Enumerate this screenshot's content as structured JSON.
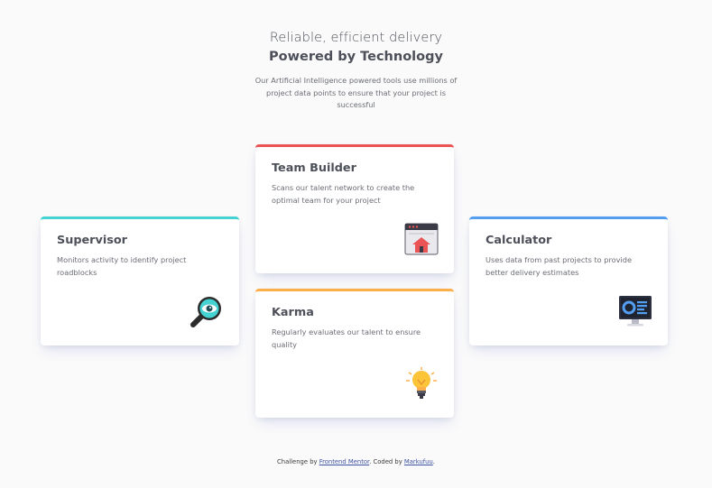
{
  "header": {
    "subtitle": "Reliable, efficient delivery",
    "title": "Powered by Technology",
    "description": "Our Artificial Intelligence powered tools use millions of project data points to ensure that your project is successful"
  },
  "cards": {
    "supervisor": {
      "title": "Supervisor",
      "text": "Monitors activity to identify project roadblocks",
      "accent": "#44d3d2",
      "icon": "magnifier-eye-icon"
    },
    "team_builder": {
      "title": "Team Builder",
      "text": "Scans our talent network to create the optimal team for your project",
      "accent": "#ea5454",
      "icon": "browser-house-icon"
    },
    "karma": {
      "title": "Karma",
      "text": "Regularly evaluates our talent to ensure quality",
      "accent": "#fcaf4a",
      "icon": "lightbulb-icon"
    },
    "calculator": {
      "title": "Calculator",
      "text": "Uses data from past projects to provide better delivery estimates",
      "accent": "#549ef2",
      "icon": "monitor-dashboard-icon"
    }
  },
  "footer": {
    "prefix": "Challenge by ",
    "link1": "Frontend Mentor",
    "middle": ". Coded by ",
    "link2": "Markufuu",
    "suffix": "."
  }
}
